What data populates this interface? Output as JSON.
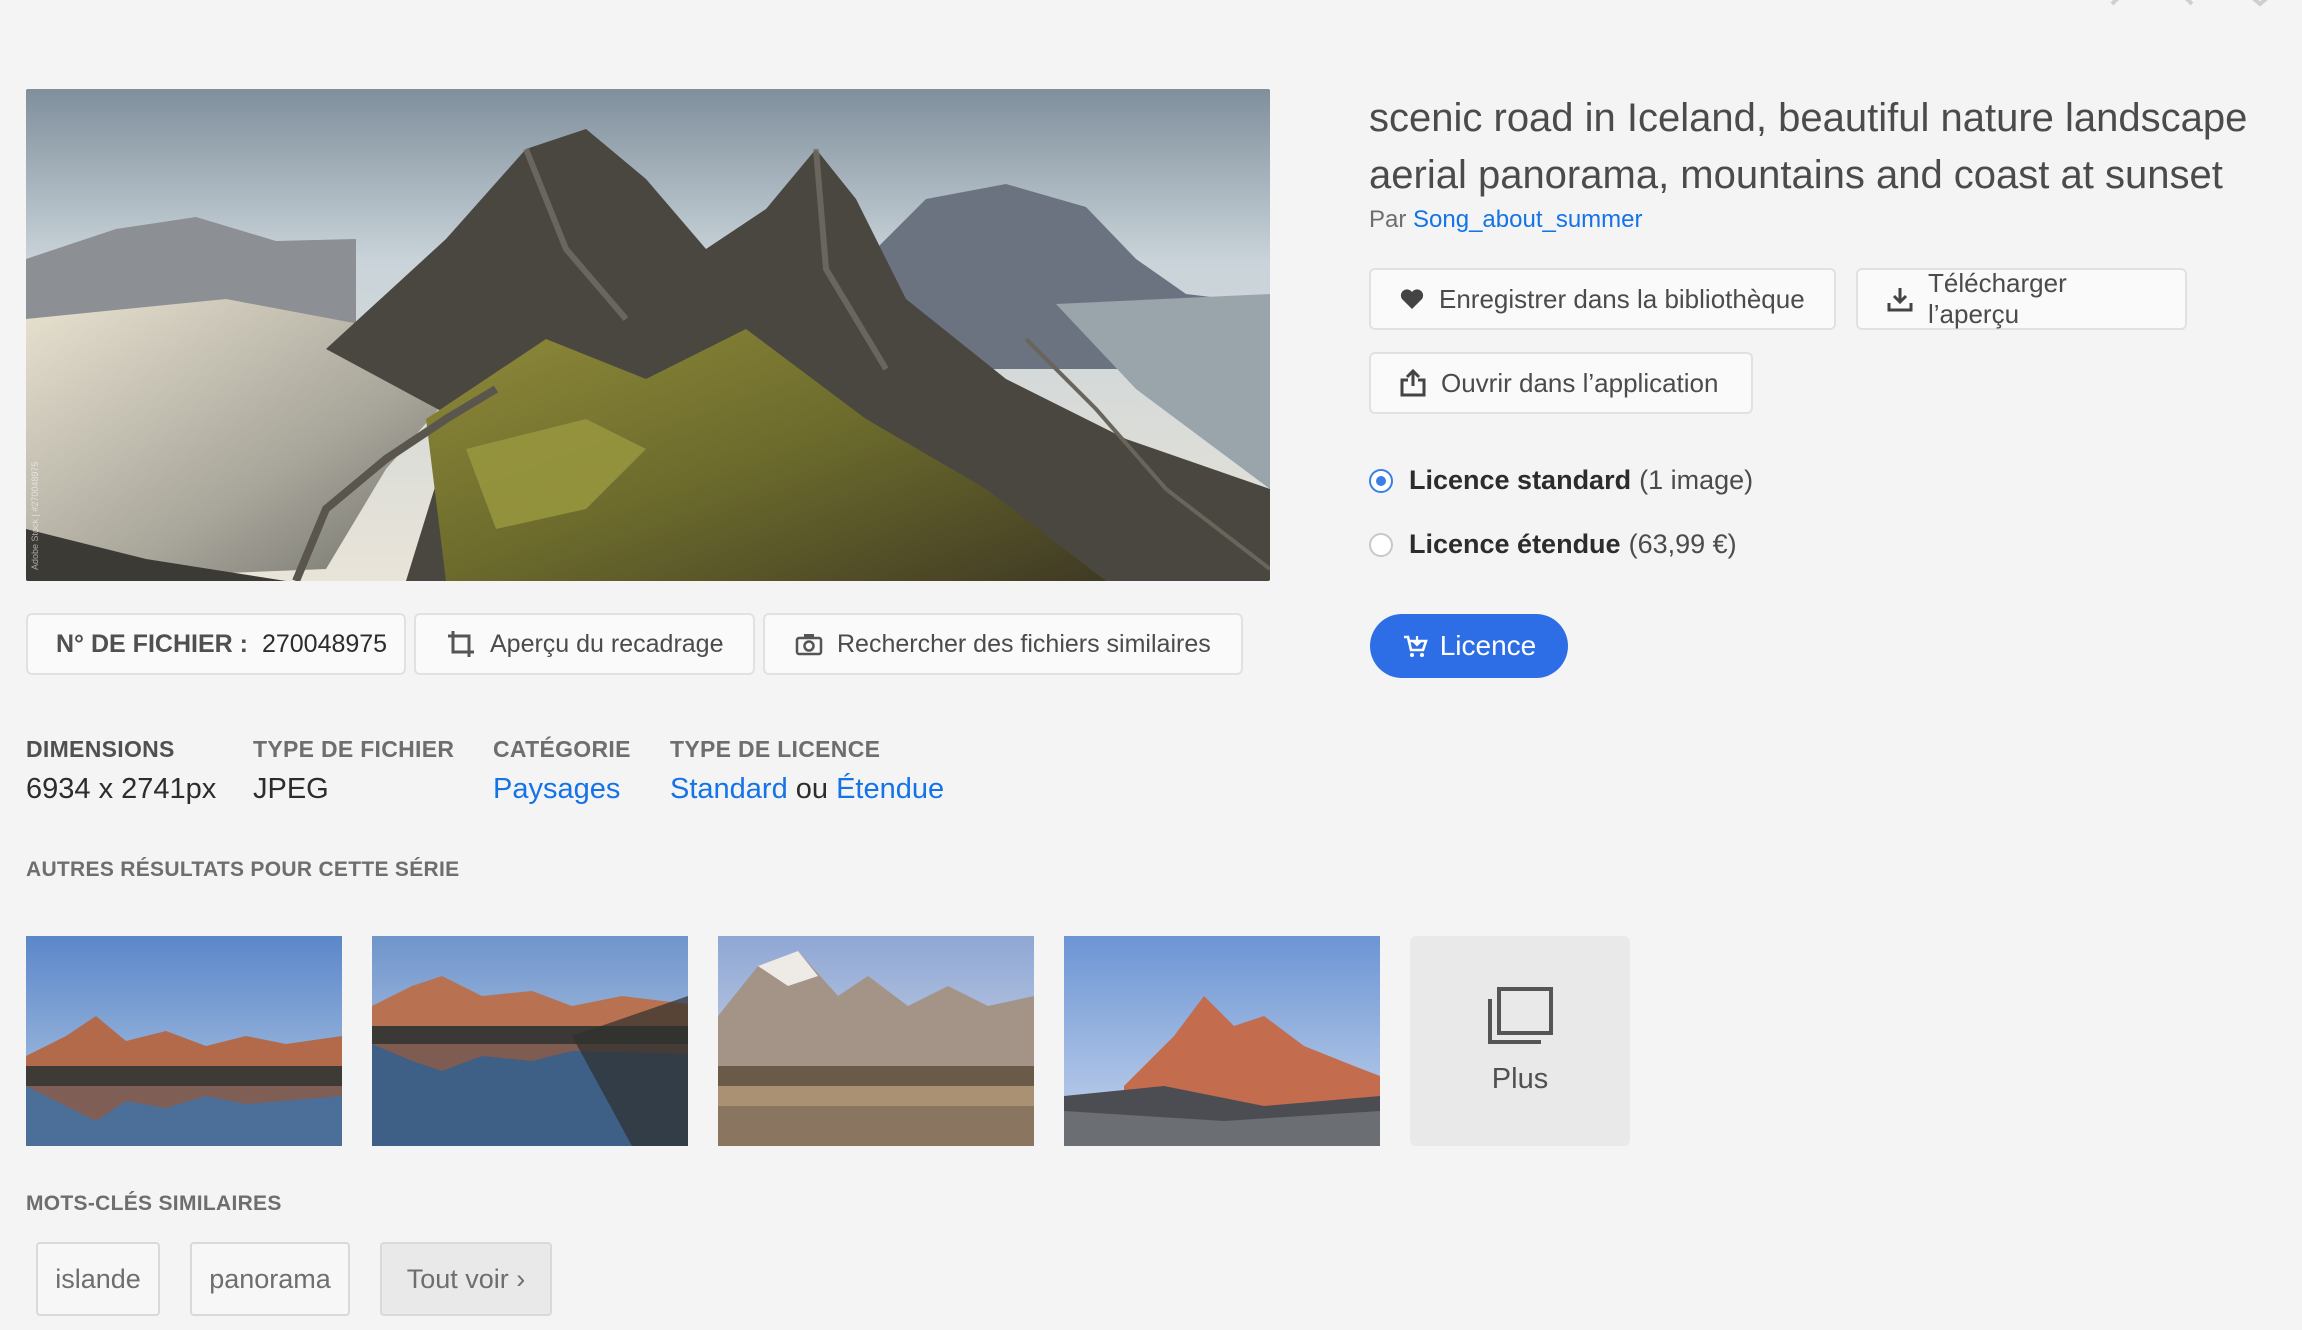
{
  "nav": {
    "prev_icon": "chevron-left-icon",
    "next_icon": "chevron-right-icon",
    "close_icon": "close-icon"
  },
  "asset": {
    "title": "scenic road in Iceland, beautiful nature landscape aerial panorama, mountains and coast at sunset",
    "by_prefix": "Par",
    "author": "Song_about_summer",
    "watermark": "Adobe Stock | #270048975"
  },
  "file_bar": {
    "file_no_label": "N° DE FICHIER :",
    "file_no_value": "270048975",
    "crop_preview": "Aperçu du recadrage",
    "find_similar": "Rechercher des fichiers similaires"
  },
  "actions": {
    "save_library": "Enregistrer dans la bibliothèque",
    "download_preview": "Télécharger l’aperçu",
    "open_in_app": "Ouvrir dans l’application"
  },
  "licenses": [
    {
      "name": "Licence standard",
      "detail": "(1 image)",
      "selected": true
    },
    {
      "name": "Licence étendue",
      "detail": "(63,99 €)",
      "selected": false
    }
  ],
  "licence_button": "Licence",
  "meta": {
    "dimensions_label": "DIMENSIONS",
    "dimensions_value": "6934 x 2741px",
    "filetype_label": "TYPE DE FICHIER",
    "filetype_value": "JPEG",
    "category_label": "CATÉGORIE",
    "category_value": "Paysages",
    "license_type_label": "TYPE DE LICENCE",
    "license_type_standard": "Standard",
    "license_type_or": "ou",
    "license_type_extended": "Étendue"
  },
  "series": {
    "heading": "AUTRES RÉSULTATS POUR CETTE SÉRIE",
    "more_label": "Plus"
  },
  "keywords": {
    "heading": "MOTS-CLÉS SIMILAIRES",
    "tags": [
      "islande",
      "panorama"
    ],
    "see_all": "Tout voir ›"
  },
  "colors": {
    "accent": "#2d6ee6",
    "link": "#1473e6"
  }
}
